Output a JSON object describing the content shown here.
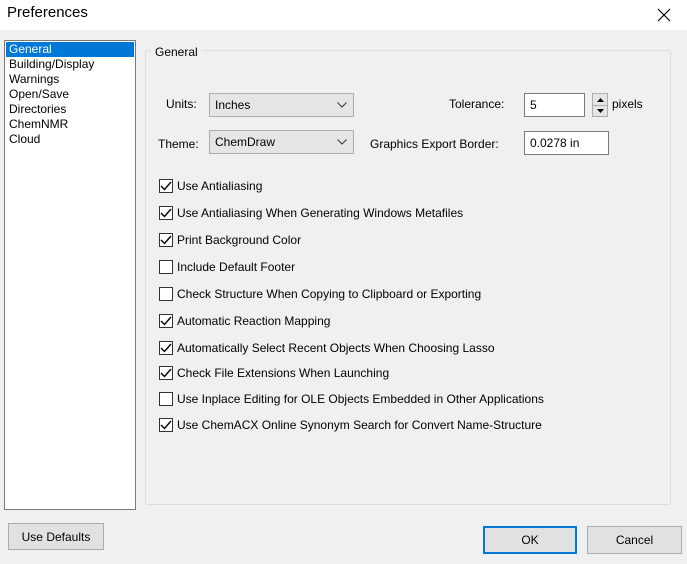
{
  "window": {
    "title": "Preferences"
  },
  "categories": [
    {
      "label": "General",
      "selected": true
    },
    {
      "label": "Building/Display",
      "selected": false
    },
    {
      "label": "Warnings",
      "selected": false
    },
    {
      "label": "Open/Save",
      "selected": false
    },
    {
      "label": "Directories",
      "selected": false
    },
    {
      "label": "ChemNMR",
      "selected": false
    },
    {
      "label": "Cloud",
      "selected": false
    }
  ],
  "general": {
    "group_title": "General",
    "units_label": "Units:",
    "units_value": "Inches",
    "theme_label": "Theme:",
    "theme_value": "ChemDraw",
    "tolerance_label": "Tolerance:",
    "tolerance_value": "5",
    "tolerance_unit": "pixels",
    "export_border_label": "Graphics Export Border:",
    "export_border_value": "0.0278 in"
  },
  "options": [
    {
      "label": "Use Antialiasing",
      "checked": true
    },
    {
      "label": "Use Antialiasing When Generating Windows Metafiles",
      "checked": true
    },
    {
      "label": "Print Background Color",
      "checked": true
    },
    {
      "label": "Include Default Footer",
      "checked": false
    },
    {
      "label": "Check Structure When Copying to Clipboard or Exporting",
      "checked": false
    },
    {
      "label": "Automatic Reaction Mapping",
      "checked": true
    },
    {
      "label": "Automatically Select Recent Objects When Choosing Lasso",
      "checked": true
    },
    {
      "label": "Check File Extensions When Launching",
      "checked": true
    },
    {
      "label": "Use Inplace Editing for OLE Objects Embedded in Other Applications",
      "checked": false
    },
    {
      "label": "Use ChemACX Online Synonym Search for Convert Name-Structure",
      "checked": true
    }
  ],
  "buttons": {
    "use_defaults": "Use Defaults",
    "ok": "OK",
    "cancel": "Cancel"
  },
  "colors": {
    "selection": "#0078d7",
    "dialog_bg": "#f0f0f0"
  }
}
